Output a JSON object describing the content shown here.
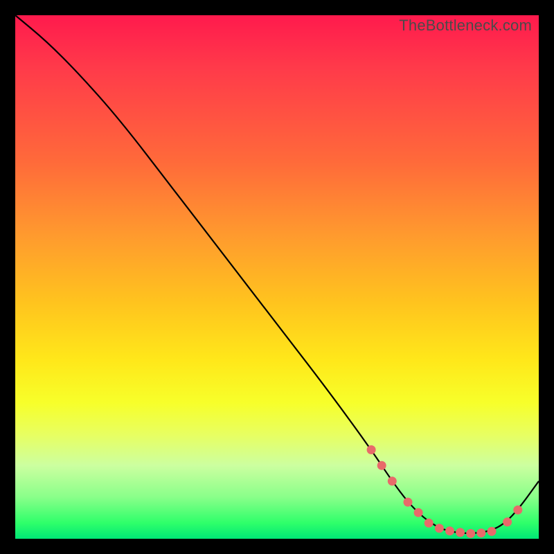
{
  "watermark": "TheBottleneck.com",
  "colors": {
    "dot": "#e86a6a",
    "curve": "#000000"
  },
  "chart_data": {
    "type": "line",
    "title": "",
    "xlabel": "",
    "ylabel": "",
    "xlim": [
      0,
      100
    ],
    "ylim": [
      0,
      100
    ],
    "grid": false,
    "curve": {
      "x": [
        0,
        6,
        12,
        20,
        30,
        40,
        50,
        60,
        68,
        72,
        75,
        78,
        81,
        84,
        87,
        90,
        93,
        96,
        100
      ],
      "y": [
        100,
        95,
        89,
        80,
        67,
        54,
        41,
        28,
        17,
        11,
        7,
        4,
        2,
        1.2,
        1.0,
        1.3,
        2.5,
        5.5,
        11
      ]
    },
    "markers": {
      "x": [
        68,
        70,
        72,
        75,
        77,
        79,
        81,
        83,
        85,
        87,
        89,
        91,
        94,
        96
      ],
      "y": [
        17,
        14,
        11,
        7,
        5,
        3,
        2,
        1.5,
        1.2,
        1.0,
        1.1,
        1.4,
        3.2,
        5.5
      ]
    }
  }
}
